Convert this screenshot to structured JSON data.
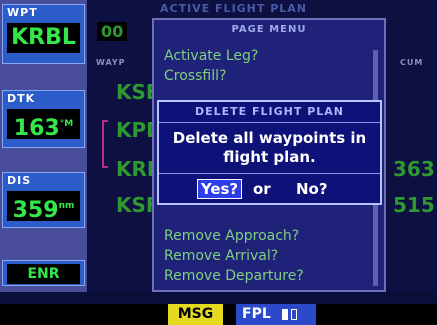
{
  "sidebar": {
    "wpt": {
      "label": "WPT",
      "value": "KRBL"
    },
    "dtk": {
      "label": "DTK",
      "value": "163",
      "unit": "°M"
    },
    "dis": {
      "label": "DIS",
      "value": "359",
      "unit": "nm"
    },
    "mode": "ENR"
  },
  "background_page": {
    "title": "ACTIVE FLIGHT PLAN",
    "plan_number": "00",
    "waypoint_header": "WAYP",
    "cum_header": "CUM",
    "wpt_fragments": [
      "KSE",
      "KPD",
      "KRE",
      "KSF"
    ],
    "cum_fragments": [
      "363",
      "515"
    ]
  },
  "page_menu": {
    "title": "PAGE MENU",
    "items": [
      "Activate Leg?",
      "Crossfill?",
      "Remove Approach?",
      "Remove Arrival?",
      "Remove Departure?"
    ]
  },
  "dialog": {
    "title": "DELETE FLIGHT PLAN",
    "message_line1": "Delete all waypoints in",
    "message_line2": "flight plan.",
    "yes_label": "Yes?",
    "or_label": "or",
    "no_label": "No?"
  },
  "statusbar": {
    "msg_label": "MSG",
    "fpl_label": "FPL"
  },
  "colors": {
    "accent_green": "#35e84a",
    "msg_yellow": "#e6da21",
    "fpl_blue": "#2b49c9",
    "dialog_bg": "#0d1178"
  }
}
